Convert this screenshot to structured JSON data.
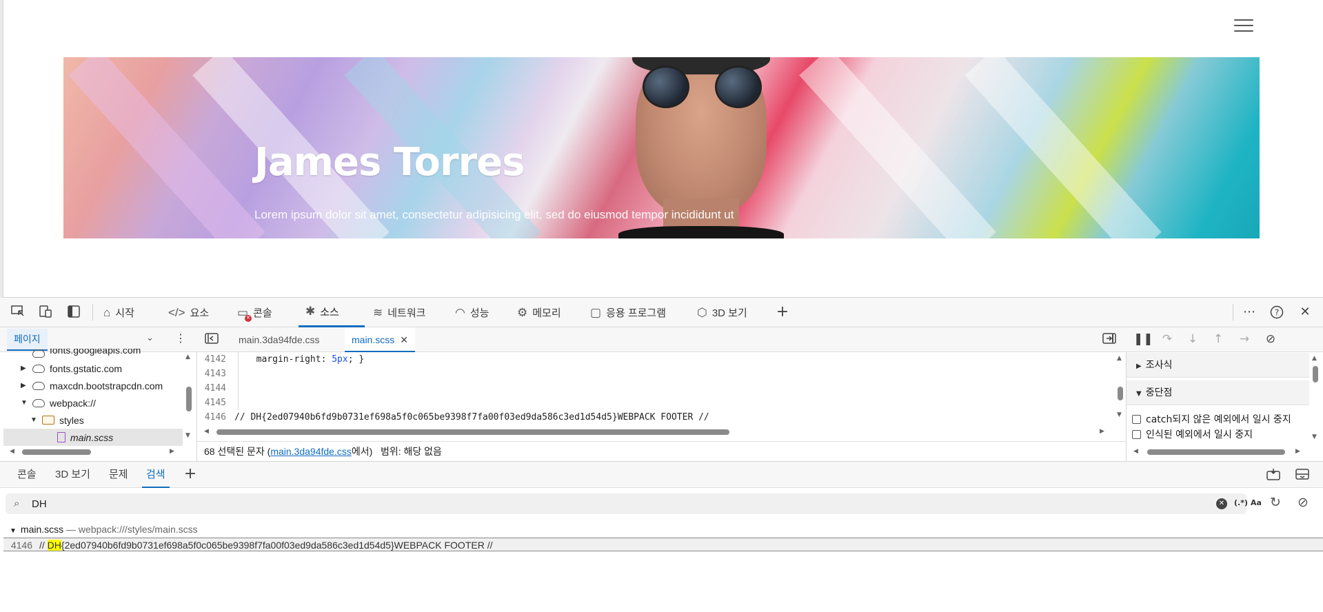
{
  "page": {
    "hero_title": "James Torres",
    "hero_subtitle": "Lorem ipsum dolor sit amet, consectetur adipisicing elit, sed do eiusmod tempor incididunt ut"
  },
  "devtools": {
    "tabs": [
      {
        "label": "시작",
        "icon": "home-icon"
      },
      {
        "label": "요소",
        "icon": "code-icon"
      },
      {
        "label": "콘솔",
        "icon": "console-icon"
      },
      {
        "label": "소스",
        "icon": "bug-icon"
      },
      {
        "label": "네트워크",
        "icon": "wifi-icon"
      },
      {
        "label": "성능",
        "icon": "gauge-icon"
      },
      {
        "label": "메모리",
        "icon": "chip-icon"
      },
      {
        "label": "응용 프로그램",
        "icon": "window-icon"
      },
      {
        "label": "3D 보기",
        "icon": "cube-icon"
      }
    ],
    "active_tab": "소스",
    "accent_color": "#0f6cbd",
    "error_badge_color": "#d13438"
  },
  "navigator": {
    "tab_label": "페이지",
    "items": [
      {
        "label": "fonts.googleapis.com",
        "type": "domain"
      },
      {
        "label": "fonts.gstatic.com",
        "type": "domain"
      },
      {
        "label": "maxcdn.bootstrapcdn.com",
        "type": "domain"
      },
      {
        "label": "webpack://",
        "type": "domain"
      },
      {
        "label": "styles",
        "type": "folder"
      },
      {
        "label": "main.scss",
        "type": "file"
      }
    ]
  },
  "editor": {
    "tabs": [
      {
        "label": "main.3da94fde.css"
      },
      {
        "label": "main.scss"
      }
    ],
    "active_tab": "main.scss",
    "lines": [
      {
        "num": "4142",
        "pre": "  margin-right: ",
        "val": "5px",
        "post": "; }"
      },
      {
        "num": "4143",
        "pre": "",
        "val": "",
        "post": ""
      },
      {
        "num": "4144",
        "pre": "",
        "val": "",
        "post": ""
      },
      {
        "num": "4145",
        "pre": "",
        "val": "",
        "post": ""
      },
      {
        "num": "4146",
        "comment": "// DH{2ed07940b6fd9b0731ef698a5f0c065be9398f7fa00f03ed9da586c3ed1d54d5}WEBPACK FOOTER //"
      }
    ],
    "status": {
      "selected": "68 선택된 문자 (",
      "source_link": "main.3da94fde.css",
      "source_suffix": "에서)",
      "scope": "범위: 해당 없음"
    }
  },
  "debugger": {
    "sections": [
      {
        "label": "조사식",
        "expanded": false
      },
      {
        "label": "중단점",
        "expanded": true
      }
    ],
    "checkboxes": [
      {
        "label": "catch되지 않은 예외에서 일시 중지",
        "checked": false
      },
      {
        "label": "인식된 예외에서 일시 중지",
        "checked": false
      }
    ]
  },
  "drawer": {
    "tabs": [
      "콘솔",
      "3D 보기",
      "문제",
      "검색"
    ],
    "active_tab": "검색",
    "search": {
      "value": "DH",
      "regex_label": "(.*)",
      "case_label": "Aa"
    },
    "results": {
      "file": "main.scss",
      "separator": " — ",
      "path": "webpack:///styles/main.scss",
      "line_num": "4146",
      "line_pre": "// ",
      "match": "DH",
      "line_post": "{2ed07940b6fd9b0731ef698a5f0c065be9398f7fa00f03ed9da586c3ed1d54d5}WEBPACK FOOTER //",
      "highlight_color": "#ffff00"
    }
  }
}
